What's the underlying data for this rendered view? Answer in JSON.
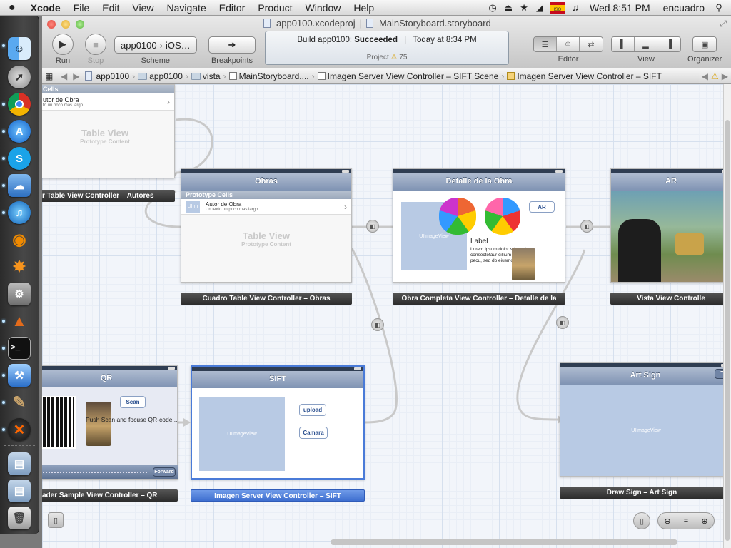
{
  "menubar": {
    "apple": "",
    "app": "Xcode",
    "items": [
      "File",
      "Edit",
      "View",
      "Navigate",
      "Editor",
      "Product",
      "Window",
      "Help"
    ],
    "clock": "Wed 8:51 PM",
    "user": "encuadro",
    "flag_label": "ISO"
  },
  "window": {
    "project_file": "app0100.xcodeproj",
    "storyboard_file": "MainStoryboard.storyboard",
    "toolbar": {
      "run": "Run",
      "stop": "Stop",
      "scheme_target": "app0100",
      "scheme_device": "iOS…",
      "scheme": "Scheme",
      "breakpoints": "Breakpoints",
      "editor": "Editor",
      "view": "View",
      "organizer": "Organizer"
    },
    "activity": {
      "build_label": "Build app0100:",
      "status": "Succeeded",
      "when": "Today at 8:34 PM",
      "project_label": "Project",
      "warnings": "75"
    },
    "jumpbar": [
      "app0100",
      "app0100",
      "vista",
      "MainStoryboard....",
      "Imagen Server View Controller – SIFT Scene",
      "Imagen Server View Controller – SIFT"
    ]
  },
  "scenes": {
    "autores": {
      "cells_header": "Cells",
      "cell_title": "utor de Obra",
      "cell_sub": "to un poco mas largo",
      "proto_title": "Table View",
      "proto_sub": "Prototype Content",
      "caption": "r Table View Controller – Autores"
    },
    "obras": {
      "title": "Obras",
      "cells_header": "Prototype Cells",
      "cell_img": "UIIm",
      "cell_title": "Autor de Obra",
      "cell_sub": "Un texto un poco mas largo",
      "proto_title": "Table View",
      "proto_sub": "Prototype Content",
      "caption": "Cuadro Table View Controller – Obras"
    },
    "detalle": {
      "title": "Detalle de la Obra",
      "image_label": "UIImageView",
      "ar_button": "AR",
      "label": "Label",
      "lorem": "Lorem ipsum dolor sit amet, consectetaur cillium adipisicing pecu, sed do eiusmod tempor...",
      "caption": "Obra Completa View Controller – Detalle de la"
    },
    "ar": {
      "title": "AR",
      "caption": "Vista View Controlle"
    },
    "qr": {
      "title": "QR",
      "scan_button": "Scan",
      "text": "Push Scan and focuse QR-code...",
      "forward_button": "Forward",
      "caption": "ader Sample View Controller – QR"
    },
    "sift": {
      "title": "SIFT",
      "image_label": "UIImageView",
      "upload_button": "upload",
      "camara_button": "Camara",
      "caption": "Imagen Server View Controller – SIFT"
    },
    "artsign": {
      "title": "Art Sign",
      "tw_button": "Twi",
      "image_label": "UIImageView",
      "caption": "Draw Sign – Art Sign"
    }
  },
  "colors": {
    "canvas_bg": "#f2f5fa",
    "navbar": "#8fa1bd",
    "selection": "#3e6fd0"
  }
}
